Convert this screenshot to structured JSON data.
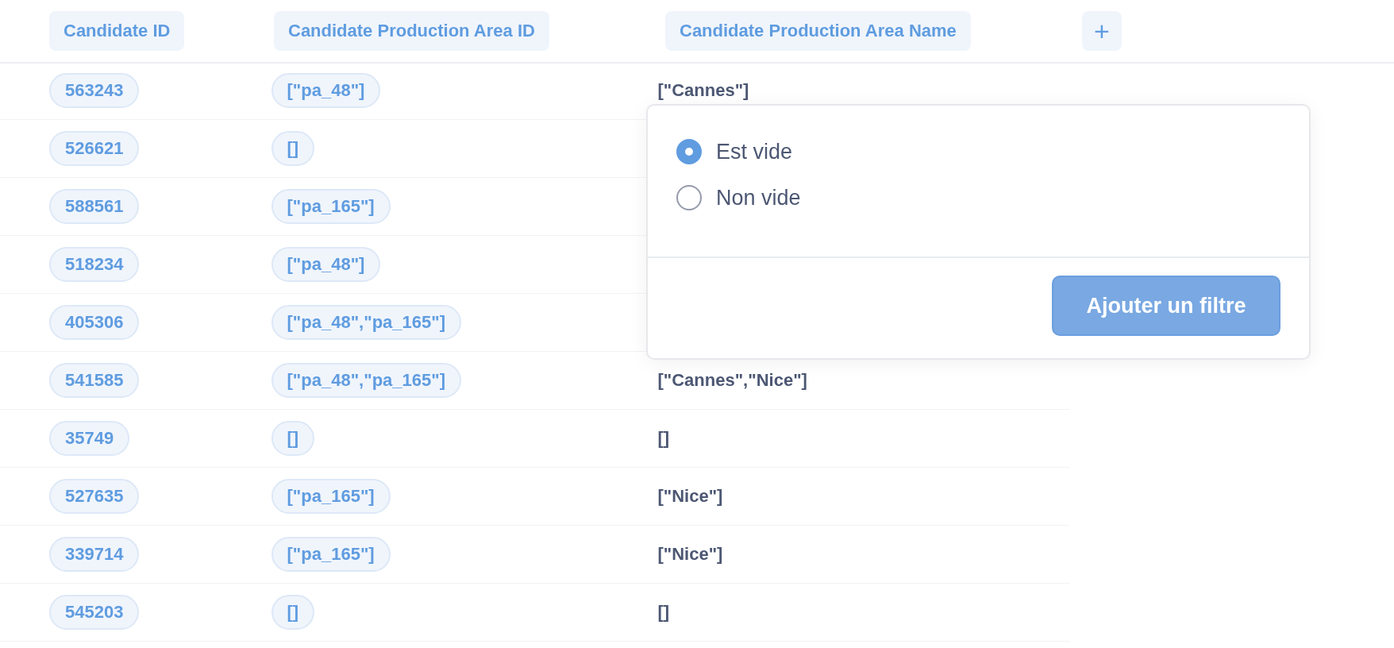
{
  "columns": [
    {
      "label": "Candidate ID"
    },
    {
      "label": "Candidate Production Area ID"
    },
    {
      "label": "Candidate Production Area Name"
    }
  ],
  "add_column_button": {
    "label": "+"
  },
  "rows": [
    {
      "candidate_id": "563243",
      "production_area_id": "[\"pa_48\"]",
      "production_area_name": "[\"Cannes\"]"
    },
    {
      "candidate_id": "526621",
      "production_area_id": "[]"
    },
    {
      "candidate_id": "588561",
      "production_area_id": "[\"pa_165\"]"
    },
    {
      "candidate_id": "518234",
      "production_area_id": "[\"pa_48\"]"
    },
    {
      "candidate_id": "405306",
      "production_area_id": "[\"pa_48\",\"pa_165\"]"
    },
    {
      "candidate_id": "541585",
      "production_area_id": "[\"pa_48\",\"pa_165\"]",
      "production_area_name": "[\"Cannes\",\"Nice\"]"
    },
    {
      "candidate_id": "35749",
      "production_area_id": "[]",
      "production_area_name": "[]"
    },
    {
      "candidate_id": "527635",
      "production_area_id": "[\"pa_165\"]",
      "production_area_name": "[\"Nice\"]"
    },
    {
      "candidate_id": "339714",
      "production_area_id": "[\"pa_165\"]",
      "production_area_name": "[\"Nice\"]"
    },
    {
      "candidate_id": "545203",
      "production_area_id": "[]",
      "production_area_name": "[]"
    }
  ],
  "filter_popup": {
    "options": [
      {
        "label": "Est vide",
        "selected": true
      },
      {
        "label": "Non vide",
        "selected": false
      }
    ],
    "submit_button": "Ajouter un filtre"
  }
}
